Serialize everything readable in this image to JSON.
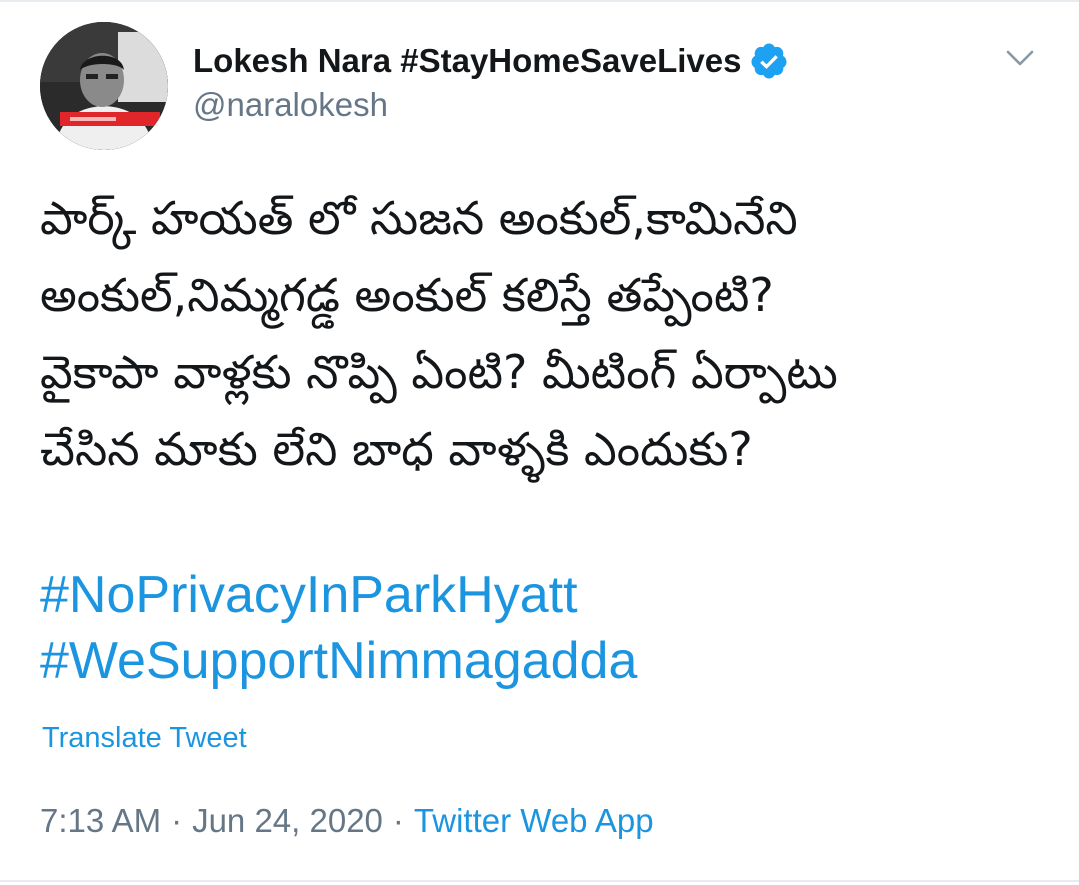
{
  "author": {
    "name": "Lokesh Nara #StayHomeSaveLives",
    "handle": "@naralokesh",
    "verified": true
  },
  "tweet": {
    "lines": [
      "పార్క్ హయత్ లో సుజన అంకుల్,కామినేని",
      "అంకుల్,నిమ్మగడ్డ అంకుల్ కలిస్తే తప్పేంటి?",
      "వైకాపా వాళ్లకు నొప్పి ఏంటి? మీటింగ్ ఏర్పాటు",
      "చేసిన మాకు లేని బాధ వాళ్ళకి ఎందుకు?"
    ],
    "hashtags": [
      "#NoPrivacyInParkHyatt",
      "#WeSupportNimmagadda"
    ],
    "translate_label": "Translate Tweet"
  },
  "meta": {
    "time": "7:13 AM",
    "separator": "·",
    "date": "Jun 24, 2020",
    "source": "Twitter Web App"
  },
  "colors": {
    "link": "#1b95e0",
    "text": "#14171a",
    "muted": "#657786",
    "verified": "#1da1f2"
  },
  "icons": {
    "verified": "verified-badge-icon",
    "menu": "chevron-down-icon"
  }
}
